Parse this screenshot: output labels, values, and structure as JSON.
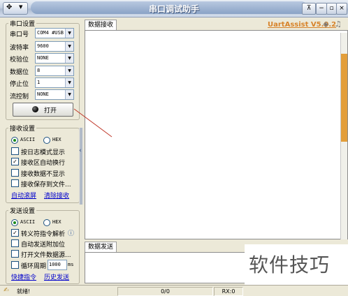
{
  "titlebar": {
    "title": "串口调试助手",
    "sysmenu_glyph": "✥",
    "pin_glyph": "⊼",
    "minimize": "−",
    "restore": "▫",
    "close": "×"
  },
  "serial": {
    "legend": "串口设置",
    "port_label": "串口号",
    "port_value": "COM4 #USB",
    "baud_label": "波特率",
    "baud_value": "9600",
    "parity_label": "校验位",
    "parity_value": "NONE",
    "databits_label": "数据位",
    "databits_value": "8",
    "stopbits_label": "停止位",
    "stopbits_value": "1",
    "flow_label": "流控制",
    "flow_value": "NONE",
    "open_button": "打开"
  },
  "receive": {
    "legend": "接收设置",
    "ascii": "ASCII",
    "hex": "HEX",
    "ascii_selected": true,
    "opt_log": "按日志模式显示",
    "opt_autowrap": "接收区自动换行",
    "opt_hide": "接收数据不显示",
    "opt_save": "接收保存到文件...",
    "link_clear": "自动滚屏",
    "link_clear2": "清除接收"
  },
  "send": {
    "legend": "发送设置",
    "ascii": "ASCII",
    "hex": "HEX",
    "opt_escape": "转义符指令解析",
    "info_glyph": "ⓘ",
    "opt_append": "自动发送附加位",
    "opt_file": "打开文件数据源...",
    "opt_cycle": "循环周期",
    "cycle_value": "1000",
    "cycle_unit": "ms",
    "link_shortcut": "快捷指令",
    "link_history": "历史发送"
  },
  "right": {
    "brand": "UartAssist V5.0.2",
    "tab_receive": "数据接收",
    "tab_send": "数据发送"
  },
  "status": {
    "ready": "就绪!",
    "counter1": "0/0",
    "counter2": "RX:0"
  },
  "watermark": "软件技巧",
  "colors": {
    "accent_orange": "#e39e3a",
    "brand": "#d7832a"
  }
}
